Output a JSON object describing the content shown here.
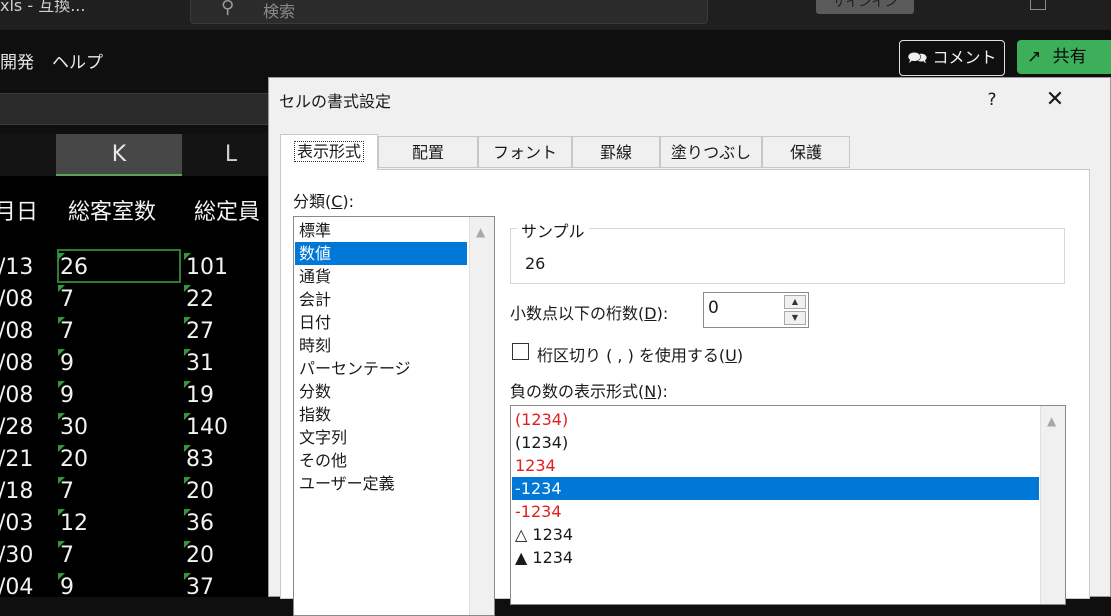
{
  "excel": {
    "file_name": "xls - 互換...",
    "search_placeholder": "検索",
    "signin_label": "サインイン",
    "menu": [
      "開発",
      "ヘルプ"
    ],
    "comment_label": "コメント",
    "share_label": "共有",
    "columns": [
      {
        "label": "K",
        "selected": true
      },
      {
        "label": "L",
        "selected": false
      }
    ],
    "headers": [
      "月日",
      "総客室数",
      "総定員"
    ],
    "rows": [
      {
        "date": "/13",
        "rooms": "26",
        "capacity": "101"
      },
      {
        "date": "/08",
        "rooms": "7",
        "capacity": "22"
      },
      {
        "date": "/08",
        "rooms": "7",
        "capacity": "27"
      },
      {
        "date": "/08",
        "rooms": "9",
        "capacity": "31"
      },
      {
        "date": "/08",
        "rooms": "9",
        "capacity": "19"
      },
      {
        "date": "/28",
        "rooms": "30",
        "capacity": "140"
      },
      {
        "date": "/21",
        "rooms": "20",
        "capacity": "83"
      },
      {
        "date": "/18",
        "rooms": "7",
        "capacity": "20"
      },
      {
        "date": "/03",
        "rooms": "12",
        "capacity": "36"
      },
      {
        "date": "/30",
        "rooms": "7",
        "capacity": "20"
      },
      {
        "date": "/04",
        "rooms": "9",
        "capacity": "37"
      }
    ],
    "accent_color": "#2e9a3a"
  },
  "dialog": {
    "title": "セルの書式設定",
    "help_label": "?",
    "close_label": "✕",
    "tabs": [
      "表示形式",
      "配置",
      "フォント",
      "罫線",
      "塗りつぶし",
      "保護"
    ],
    "active_tab": "表示形式",
    "category_label_pre": "分類(",
    "category_label_key": "C",
    "category_label_post": "):",
    "categories": [
      "標準",
      "数値",
      "通貨",
      "会計",
      "日付",
      "時刻",
      "パーセンテージ",
      "分数",
      "指数",
      "文字列",
      "その他",
      "ユーザー定義"
    ],
    "selected_category": "数値",
    "sample_label": "サンプル",
    "sample_value": "26",
    "decimal_label_pre": "小数点以下の桁数(",
    "decimal_label_key": "D",
    "decimal_label_post": "):",
    "decimal_value": "0",
    "thousands_label_pre": "桁区切り ( , ) を使用する(",
    "thousands_label_key": "U",
    "thousands_label_post": ")",
    "thousands_checked": false,
    "negative_label_pre": "負の数の表示形式(",
    "negative_label_key": "N",
    "negative_label_post": "):",
    "negative_formats": [
      {
        "text": "(1234)",
        "color": "red"
      },
      {
        "text": "(1234)",
        "color": "black"
      },
      {
        "text": "1234",
        "color": "red"
      },
      {
        "text": "-1234",
        "color": "black",
        "selected": true
      },
      {
        "text": "-1234",
        "color": "red"
      },
      {
        "text": "△ 1234",
        "color": "black"
      },
      {
        "text": "▲ 1234",
        "color": "black"
      }
    ],
    "selection_color": "#0078d7",
    "negative_red_color": "#e02020"
  }
}
